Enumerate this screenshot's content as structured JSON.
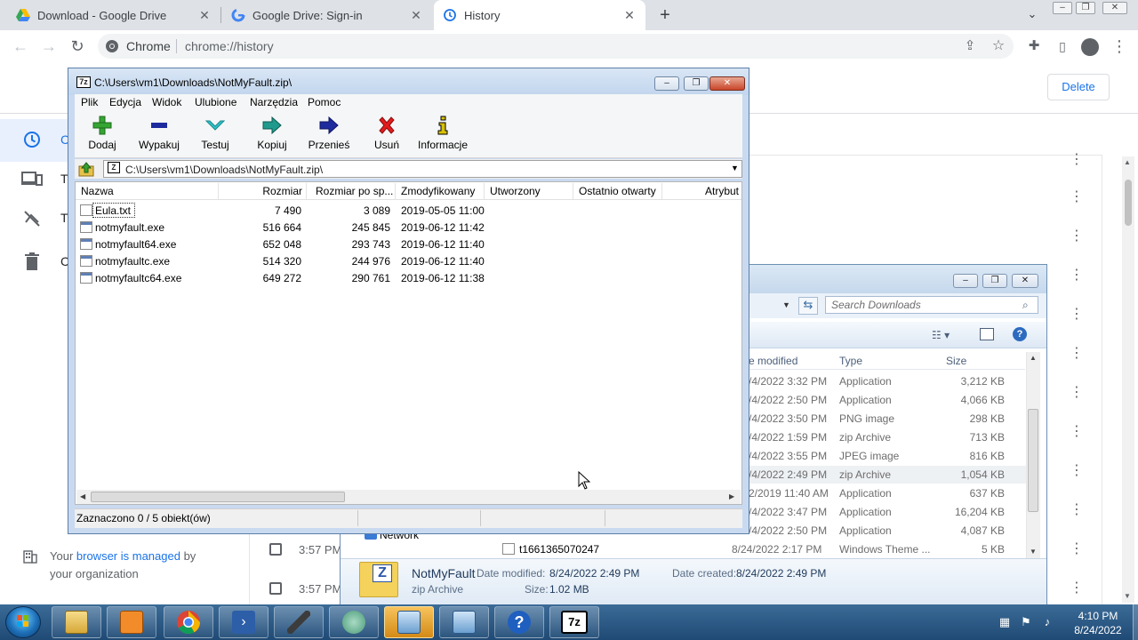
{
  "browser": {
    "tabs": [
      {
        "title": "Download - Google Drive",
        "icon": "google-drive-icon"
      },
      {
        "title": "Google Drive: Sign-in",
        "icon": "google-g-icon"
      },
      {
        "title": "History",
        "icon": "history-clock-icon"
      }
    ],
    "new_tab_glyph": "+",
    "omnibox": {
      "site_name": "Chrome",
      "url": "chrome://history"
    }
  },
  "history_page": {
    "delete_label": "Delete",
    "sidebar_partial": {
      "first_initial": "C",
      "second_initial": "T",
      "third_initial": "T",
      "fourth_initial": "C"
    },
    "managed_text_1": "Your ",
    "managed_link": "browser is managed",
    "managed_text_2": " by",
    "managed_text_3": "your organization",
    "visible_times": [
      "3:57 PM",
      "3:57 PM"
    ]
  },
  "explorer": {
    "search_placeholder": "Search Downloads",
    "columns": {
      "date_modified": "e modified",
      "type": "Type",
      "size": "Size"
    },
    "rows": [
      {
        "date": "/4/2022 3:32 PM",
        "type": "Application",
        "size": "3,212 KB"
      },
      {
        "date": "/4/2022 2:50 PM",
        "type": "Application",
        "size": "4,066 KB"
      },
      {
        "date": "/4/2022 3:50 PM",
        "type": "PNG image",
        "size": "298 KB"
      },
      {
        "date": "/4/2022 1:59 PM",
        "type": "zip Archive",
        "size": "713 KB"
      },
      {
        "date": "/4/2022 3:55 PM",
        "type": "JPEG image",
        "size": "816 KB"
      },
      {
        "date": "/4/2022 2:49 PM",
        "type": "zip Archive",
        "size": "1,054 KB"
      },
      {
        "date": "2/2019 11:40 AM",
        "type": "Application",
        "size": "637 KB"
      },
      {
        "date": "/4/2022 3:47 PM",
        "type": "Application",
        "size": "16,204 KB"
      },
      {
        "date": "/4/2022 2:50 PM",
        "type": "Application",
        "size": "4,087 KB"
      },
      {
        "date": "8/24/2022 2:17 PM",
        "type": "Windows Theme ...",
        "size": "5 KB"
      }
    ],
    "nav_partial": "Network",
    "file_partial": "t1661365070247",
    "details": {
      "name": "NotMyFault",
      "kind": "zip Archive",
      "date_modified_label": "Date modified:",
      "date_modified": "8/24/2022 2:49 PM",
      "date_created_label": "Date created:",
      "date_created": "8/24/2022 2:49 PM",
      "size_label": "Size:",
      "size": "1.02 MB"
    }
  },
  "sevenzip": {
    "title": "C:\\Users\\vm1\\Downloads\\NotMyFault.zip\\",
    "app_badge": "7z",
    "menu": [
      "Plik",
      "Edycja",
      "Widok",
      "Ulubione",
      "Narzędzia",
      "Pomoc"
    ],
    "toolbar": [
      "Dodaj",
      "Wypakuj",
      "Testuj",
      "Kopiuj",
      "Przenieś",
      "Usuń",
      "Informacje"
    ],
    "path": "C:\\Users\\vm1\\Downloads\\NotMyFault.zip\\",
    "columns": [
      "Nazwa",
      "Rozmiar",
      "Rozmiar po sp...",
      "Zmodyfikowany",
      "Utworzony",
      "Ostatnio otwarty",
      "Atrybut"
    ],
    "files": [
      {
        "name": "Eula.txt",
        "size": "7 490",
        "packed": "3 089",
        "modified": "2019-05-05 11:00",
        "kind": "txt"
      },
      {
        "name": "notmyfault.exe",
        "size": "516 664",
        "packed": "245 845",
        "modified": "2019-06-12 11:42",
        "kind": "exe"
      },
      {
        "name": "notmyfault64.exe",
        "size": "652 048",
        "packed": "293 743",
        "modified": "2019-06-12 11:40",
        "kind": "exe"
      },
      {
        "name": "notmyfaultc.exe",
        "size": "514 320",
        "packed": "244 976",
        "modified": "2019-06-12 11:40",
        "kind": "exe"
      },
      {
        "name": "notmyfaultc64.exe",
        "size": "649 272",
        "packed": "290 761",
        "modified": "2019-06-12 11:38",
        "kind": "exe"
      }
    ],
    "status": "Zaznaczono 0 / 5 obiekt(ów)"
  },
  "taskbar": {
    "time": "4:10 PM",
    "date": "8/24/2022",
    "pinned_icons": [
      "file-explorer-icon",
      "media-player-icon",
      "chrome-icon",
      "powershell-icon",
      "microphone-icon",
      "network-globe-icon",
      "explorer-window-icon",
      "explorer-window-icon",
      "help-icon",
      "sevenzip-icon"
    ]
  }
}
